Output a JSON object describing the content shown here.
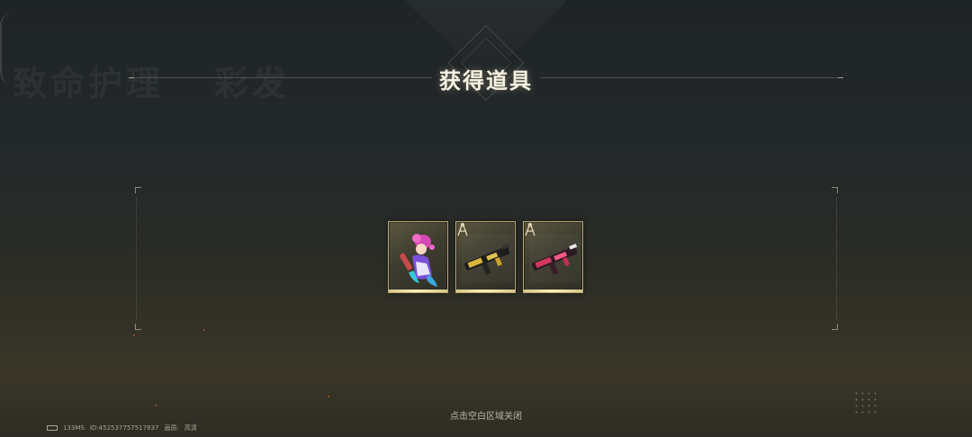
{
  "header": {
    "title": "获得道具",
    "background_text": [
      "致命护理",
      "彩发"
    ]
  },
  "rewards": [
    {
      "name": "pink-hair-character-skin",
      "type": "character"
    },
    {
      "name": "gold-black-weapon-blueprint",
      "type": "blueprint"
    },
    {
      "name": "pink-red-weapon-blueprint",
      "type": "blueprint"
    }
  ],
  "footer": {
    "close_hint": "点击空白区域关闭"
  },
  "status_bar": {
    "ping": "133MS",
    "player_id": "ID:452537757517837",
    "quality_label": "画质:",
    "quality_value": "高清"
  },
  "colors": {
    "frame_gold": "#b8a873",
    "title": "#f6f1e0",
    "background": "#23282a"
  }
}
